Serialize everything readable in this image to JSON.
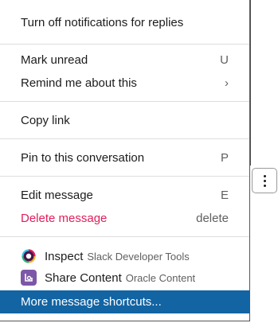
{
  "menu": {
    "notifications_label": "Turn off notifications for replies",
    "mark_unread_label": "Mark unread",
    "mark_unread_shortcut": "U",
    "remind_label": "Remind me about this",
    "remind_chevron": "›",
    "copy_link_label": "Copy link",
    "pin_label": "Pin to this conversation",
    "pin_shortcut": "P",
    "edit_label": "Edit message",
    "edit_shortcut": "E",
    "delete_label": "Delete message",
    "delete_shortcut": "delete",
    "delete_color": "#e01e5a",
    "apps": [
      {
        "name": "Inspect",
        "source": "Slack Developer Tools",
        "icon": "gear-icon"
      },
      {
        "name": "Share Content",
        "source": "Oracle Content",
        "icon": "share-content-icon"
      }
    ],
    "more_shortcuts_label": "More message shortcuts...",
    "highlight_color": "#1264a3"
  }
}
